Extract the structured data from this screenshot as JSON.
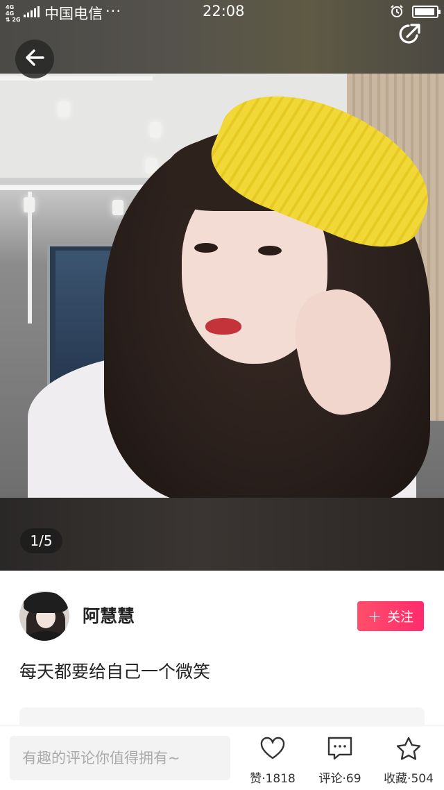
{
  "status_bar": {
    "network": "4G 4G\n⇅ 2G",
    "carrier": "中国电信",
    "more": "···",
    "time": "22:08"
  },
  "media": {
    "page_counter": "1/5"
  },
  "author": {
    "name": "阿慧慧",
    "follow_label": "关注",
    "follow_plus": "+"
  },
  "post": {
    "caption": "每天都要给自己一个微笑"
  },
  "bottom_bar": {
    "comment_placeholder": "有趣的评论你值得拥有~",
    "like_label": "赞·1818",
    "comment_label": "评论·69",
    "favorite_label": "收藏·504"
  },
  "colors": {
    "follow_button": "#ff3b6b",
    "beret": "#f2d836"
  },
  "icons": {
    "back": "arrow-left-icon",
    "share": "share-icon",
    "like": "heart-icon",
    "comment": "comment-dots-icon",
    "favorite": "star-icon",
    "alarm": "alarm-icon",
    "battery": "battery-icon",
    "signal": "signal-icon"
  }
}
